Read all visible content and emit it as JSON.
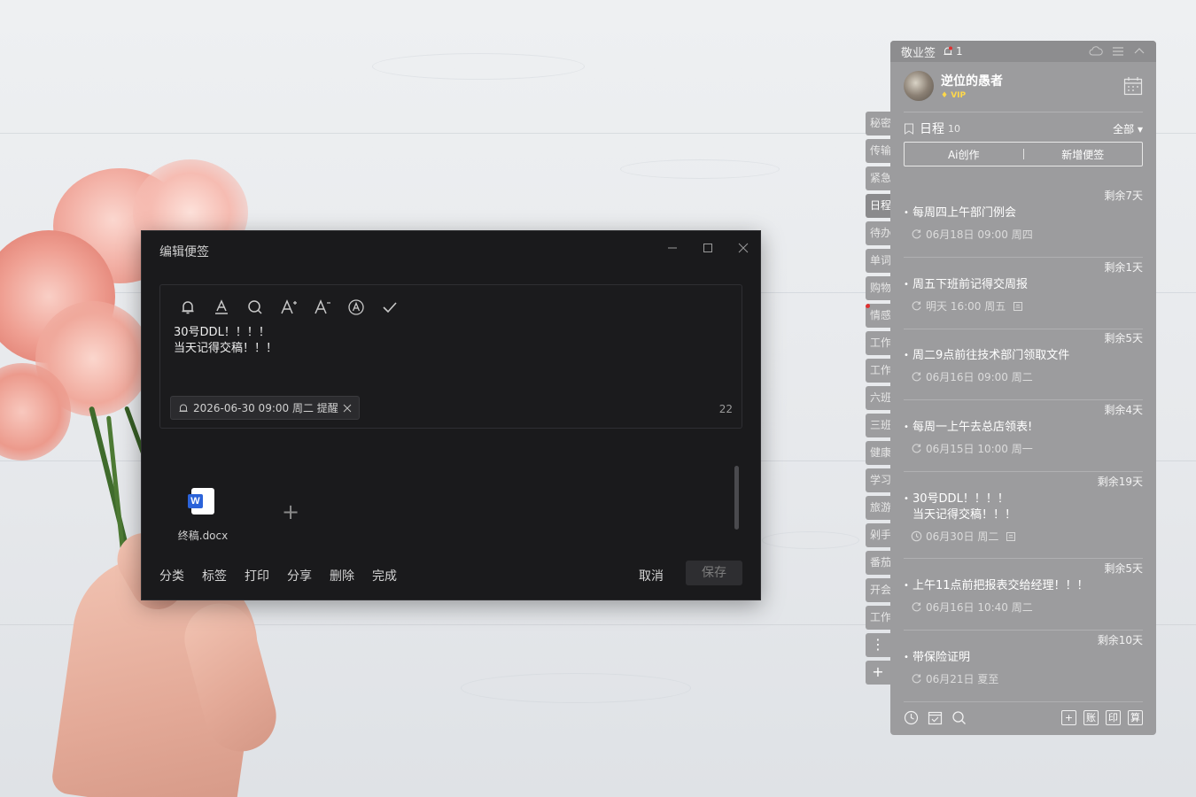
{
  "dialog": {
    "title": "编辑便签",
    "note_lines": "30号DDL！！！！\n当天记得交稿！！！",
    "reminder": "2026-06-30 09:00 周二 提醒",
    "char_count": "22",
    "attachment_name": "终稿.docx",
    "attachment_badge": "W",
    "add_symbol": "+",
    "footer_actions": [
      "分类",
      "标签",
      "打印",
      "分享",
      "删除",
      "完成"
    ],
    "cancel_label": "取消",
    "save_label": "保存"
  },
  "side_tabs": [
    {
      "label": "秘密",
      "active": false
    },
    {
      "label": "传输",
      "active": false
    },
    {
      "label": "紧急",
      "active": false
    },
    {
      "label": "日程",
      "active": true
    },
    {
      "label": "待办",
      "active": false
    },
    {
      "label": "单词",
      "active": false
    },
    {
      "label": "购物",
      "active": false
    },
    {
      "label": "情感",
      "active": false,
      "dot": true
    },
    {
      "label": "工作",
      "active": false
    },
    {
      "label": "工作",
      "active": false
    },
    {
      "label": "六班",
      "active": false
    },
    {
      "label": "三班",
      "active": false
    },
    {
      "label": "健康",
      "active": false
    },
    {
      "label": "学习",
      "active": false
    },
    {
      "label": "旅游",
      "active": false
    },
    {
      "label": "剁手",
      "active": false
    },
    {
      "label": "番茄",
      "active": false
    },
    {
      "label": "开会",
      "active": false
    },
    {
      "label": "工作",
      "active": false
    }
  ],
  "side_more": "⋮",
  "side_add": "+",
  "panel": {
    "app_name": "敬业签",
    "bell_count": "1",
    "user_name": "逆位的愚者",
    "vip": "VIP",
    "section_title": "日程",
    "section_count": "10",
    "filter_label": "全部",
    "ai_label": "Ai创作",
    "new_note_label": "新增便签",
    "events": [
      {
        "remain": "剩余7天",
        "title": "每周四上午部门例会",
        "meta": "06月18日 09:00 周四",
        "repeat": true,
        "lock": false
      },
      {
        "remain": "剩余1天",
        "title": "周五下班前记得交周报",
        "meta": "明天 16:00 周五",
        "repeat": true,
        "lock": true
      },
      {
        "remain": "剩余5天",
        "title": "周二9点前往技术部门领取文件",
        "meta": "06月16日 09:00 周二",
        "repeat": true,
        "lock": false
      },
      {
        "remain": "剩余4天",
        "title": "每周一上午去总店领表!",
        "meta": "06月15日 10:00 周一",
        "repeat": true,
        "lock": false
      },
      {
        "remain": "剩余19天",
        "title": "30号DDL！！！！\n当天记得交稿！！！",
        "meta": "06月30日 周二",
        "repeat": false,
        "lock": true
      },
      {
        "remain": "剩余5天",
        "title": "上午11点前把报表交给经理！！！",
        "meta": "06月16日 10:40 周二",
        "repeat": true,
        "lock": false
      },
      {
        "remain": "剩余10天",
        "title": "带保险证明",
        "meta": "06月21日 夏至",
        "repeat": true,
        "lock": false
      }
    ],
    "bottom_right": [
      "+",
      "账",
      "印",
      "算"
    ]
  }
}
